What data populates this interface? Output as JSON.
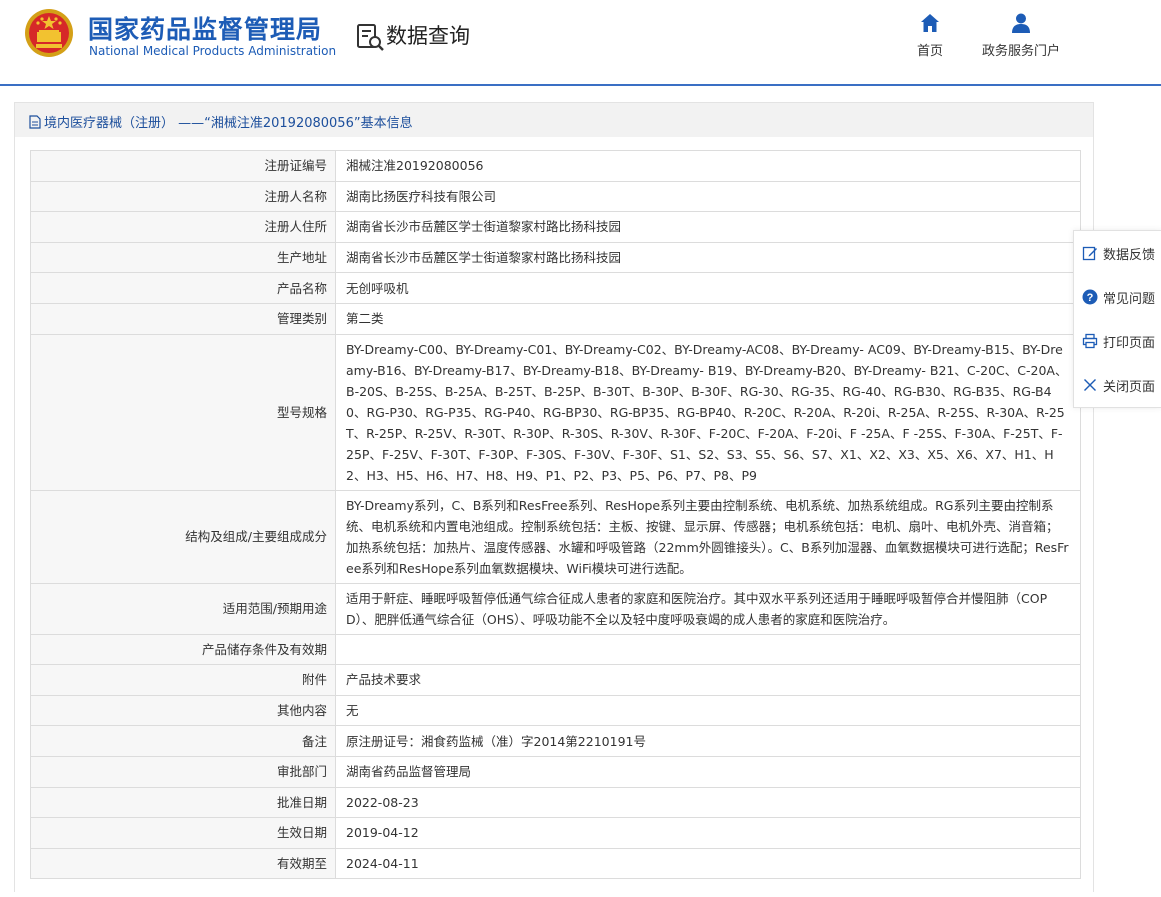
{
  "header": {
    "agency_cn": "国家药品监督管理局",
    "agency_en": "National Medical Products Administration",
    "page_title": "数据查询",
    "nav": [
      {
        "label": "首页",
        "icon": "home-icon"
      },
      {
        "label": "政务服务门户",
        "icon": "user-icon"
      }
    ]
  },
  "panel": {
    "title": "境内医疗器械（注册） ——“湘械注准20192080056”基本信息"
  },
  "rows": [
    {
      "key": "注册证编号",
      "value": "湘械注准20192080056"
    },
    {
      "key": "注册人名称",
      "value": "湖南比扬医疗科技有限公司"
    },
    {
      "key": "注册人住所",
      "value": "湖南省长沙市岳麓区学士街道黎家村路比扬科技园"
    },
    {
      "key": "生产地址",
      "value": "湖南省长沙市岳麓区学士街道黎家村路比扬科技园"
    },
    {
      "key": "产品名称",
      "value": "无创呼吸机"
    },
    {
      "key": "管理类别",
      "value": "第二类"
    },
    {
      "key": "型号规格",
      "value": "BY-Dreamy-C00、BY-Dreamy-C01、BY-Dreamy-C02、BY-Dreamy-AC08、BY-Dreamy- AC09、BY-Dreamy-B15、BY-Dreamy-B16、BY-Dreamy-B17、BY-Dreamy-B18、BY-Dreamy- B19、BY-Dreamy-B20、BY-Dreamy- B21、C-20C、C-20A、B-20S、B-25S、B-25A、B-25T、B-25P、B-30T、B-30P、B-30F、RG-30、RG-35、RG-40、RG-B30、RG-B35、RG-B40、RG-P30、RG-P35、RG-P40、RG-BP30、RG-BP35、RG-BP40、R-20C、R-20A、R-20i、R-25A、R-25S、R-30A、R-25T、R-25P、R-25V、R-30T、R-30P、R-30S、R-30V、R-30F、F-20C、F-20A、F-20i、F -25A、F -25S、F-30A、F-25T、F-25P、F-25V、F-30T、F-30P、F-30S、F-30V、F-30F、S1、S2、S3、S5、S6、S7、X1、X2、X3、X5、X6、X7、H1、H2、H3、H5、H6、H7、H8、H9、P1、P2、P3、P5、P6、P7、P8、P9"
    },
    {
      "key": "结构及组成/主要组成成分",
      "value": "BY-Dreamy系列，C、B系列和ResFree系列、ResHope系列主要由控制系统、电机系统、加热系统组成。RG系列主要由控制系统、电机系统和内置电池组成。控制系统包括：主板、按键、显示屏、传感器；电机系统包括：电机、扇叶、电机外壳、消音箱；加热系统包括：加热片、温度传感器、水罐和呼吸管路（22mm外圆锥接头）。C、B系列加湿器、血氧数据模块可进行选配；ResFree系列和ResHope系列血氧数据模块、WiFi模块可进行选配。"
    },
    {
      "key": "适用范围/预期用途",
      "value": "适用于鼾症、睡眠呼吸暂停低通气综合征成人患者的家庭和医院治疗。其中双水平系列还适用于睡眠呼吸暂停合并慢阻肺（COPD）、肥胖低通气综合征（OHS）、呼吸功能不全以及轻中度呼吸衰竭的成人患者的家庭和医院治疗。"
    },
    {
      "key": "产品储存条件及有效期",
      "value": ""
    },
    {
      "key": "附件",
      "value": "产品技术要求"
    },
    {
      "key": "其他内容",
      "value": "无"
    },
    {
      "key": "备注",
      "value": "原注册证号：湘食药监械（准）字2014第2210191号"
    },
    {
      "key": "审批部门",
      "value": "湖南省药品监督管理局"
    },
    {
      "key": "批准日期",
      "value": "2022-08-23"
    },
    {
      "key": "生效日期",
      "value": "2019-04-12"
    },
    {
      "key": "有效期至",
      "value": "2024-04-11"
    }
  ],
  "float_menu": [
    {
      "label": "数据反馈",
      "icon": "edit-icon"
    },
    {
      "label": "常见问题",
      "icon": "question-icon"
    },
    {
      "label": "打印页面",
      "icon": "print-icon"
    },
    {
      "label": "关闭页面",
      "icon": "close-icon"
    }
  ],
  "colors": {
    "brand": "#1d5cb6",
    "header_rule": "#3a6fc4"
  }
}
